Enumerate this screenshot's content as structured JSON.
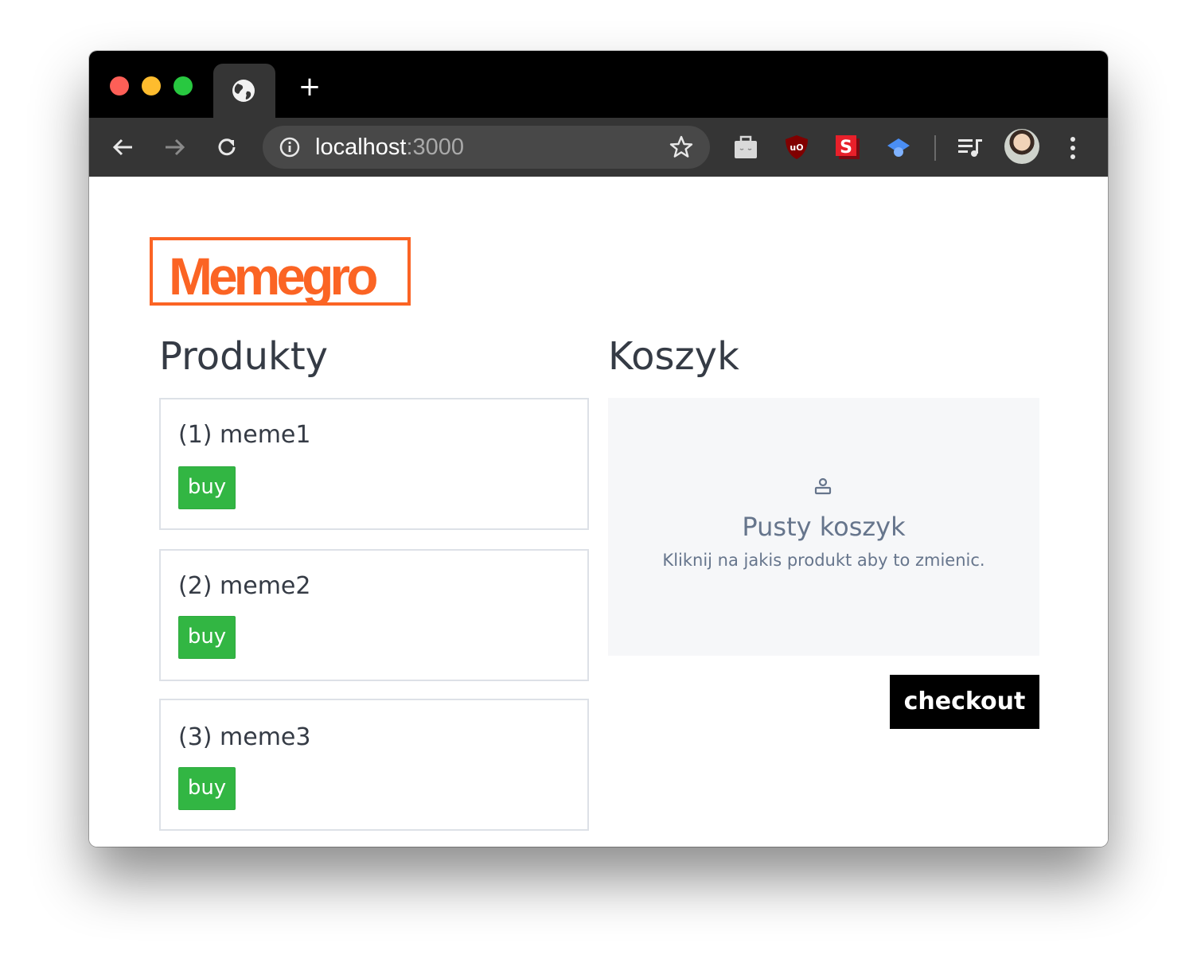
{
  "browser": {
    "url_host": "localhost",
    "url_port": ":3000",
    "tab_icon": "globe-icon",
    "new_tab_label": "+",
    "extensions": [
      "briefcase-icon",
      "ublock-icon",
      "s-extension-icon",
      "graduation-cap-icon",
      "playlist-icon"
    ]
  },
  "page": {
    "logo": "Memegro",
    "products_title": "Produkty",
    "cart_title": "Koszyk",
    "products": [
      {
        "name": "(1) meme1",
        "buy_label": "buy"
      },
      {
        "name": "(2) meme2",
        "buy_label": "buy"
      },
      {
        "name": "(3) meme3",
        "buy_label": "buy"
      }
    ],
    "cart": {
      "empty_title": "Pusty koszyk",
      "empty_subtitle": "Kliknij na jakis produkt aby to zmienic."
    },
    "checkout_label": "checkout"
  },
  "colors": {
    "brand": "#fb6424",
    "buy": "#32b643",
    "checkout": "#000000"
  }
}
